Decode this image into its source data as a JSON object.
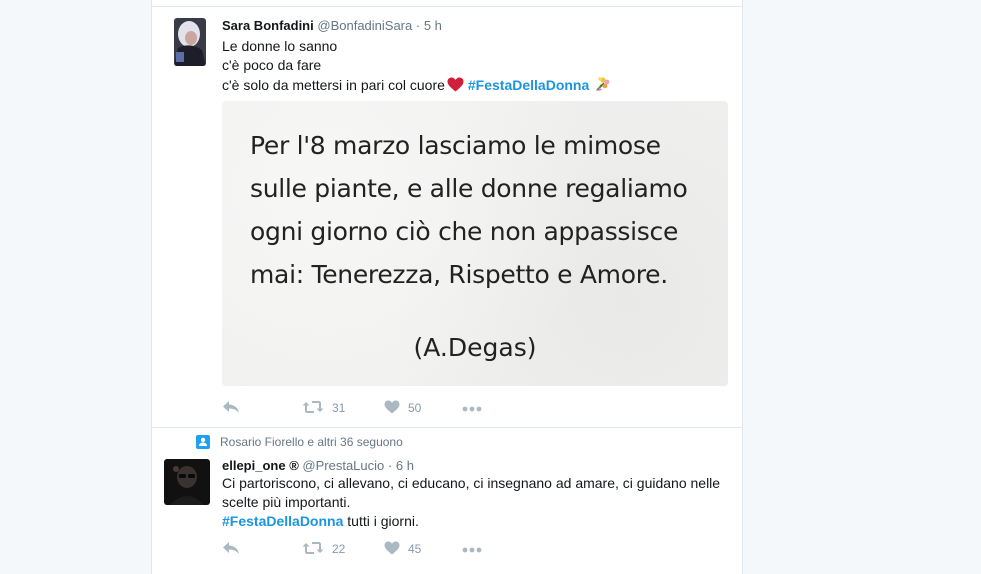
{
  "tweets": [
    {
      "name": "Sara Bonfadini",
      "handle": "@BonfadiniSara",
      "dot": "·",
      "time": "5 h",
      "lines": [
        "Le donne lo sanno",
        "c'è poco da fare",
        "c'è solo da mettersi in pari col cuore"
      ],
      "hashtag": "#FestaDellaDonna",
      "media": {
        "quote_lines": [
          "Per l'8 marzo lasciamo le mimose",
          "sulle piante, e alle donne regaliamo",
          "ogni giorno ciò che non appassisce",
          "mai: Tenerezza, Rispetto e Amore."
        ],
        "author": "(A.Degas)"
      },
      "retweets": "31",
      "likes": "50"
    },
    {
      "context": "Rosario Fiorello e altri 36 seguono",
      "name": "ellepi_one ®",
      "handle": "@PrestaLucio",
      "dot": "·",
      "time": "6 h",
      "line1": "Ci partoriscono, ci allevano, ci educano, ci insegnano ad amare, ci guidano nelle",
      "line2": "scelte più importanti.",
      "hashtag": "#FestaDellaDonna",
      "after_hashtag": " tutti i giorni.",
      "retweets": "22",
      "likes": "45"
    }
  ],
  "colors": {
    "hashtag": "#1b95e0",
    "heart": "#e0245e",
    "action_gray": "#aab8c2",
    "context_icon": "#1da1f2"
  },
  "icons": [
    "reply-icon",
    "retweet-icon",
    "like-icon",
    "more-icon",
    "heart-emoji",
    "bouquet-emoji",
    "follow-context-icon"
  ]
}
